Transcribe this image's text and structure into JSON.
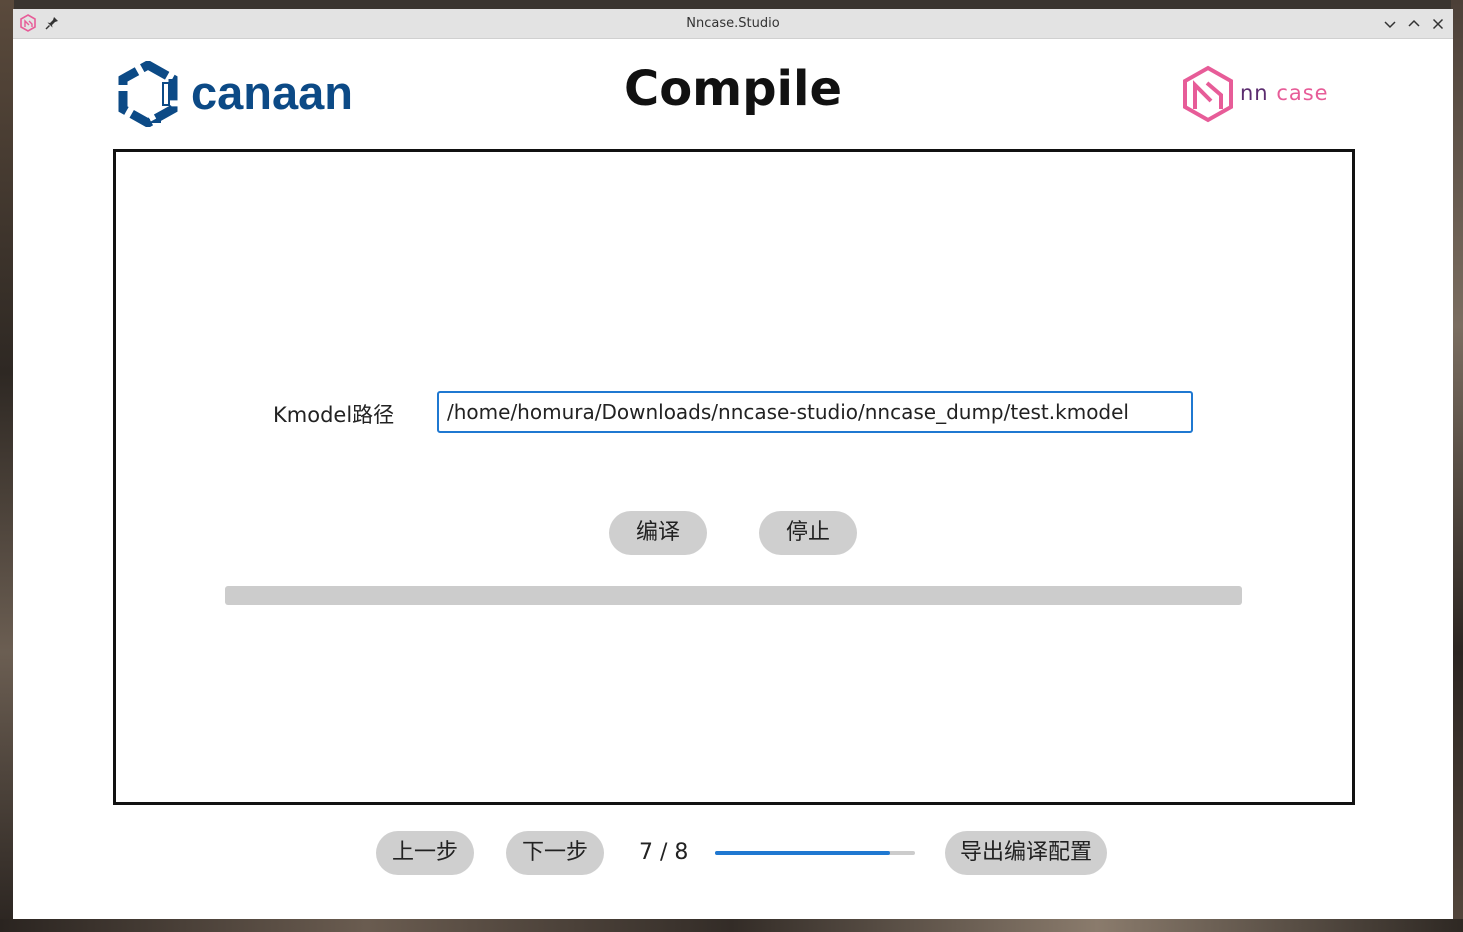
{
  "window": {
    "title": "Nncase.Studio",
    "controls": [
      "chevron-down-icon",
      "chevron-up-icon",
      "close-icon"
    ]
  },
  "header": {
    "left_logo_text": "canaan",
    "page_title": "Compile",
    "right_logo_text_nn": "nn",
    "right_logo_text_case": "case"
  },
  "compile": {
    "kmodel_label": "Kmodel路径",
    "kmodel_path": "/home/homura/Downloads/nncase-studio/nncase_dump/test.kmodel",
    "compile_button": "编译",
    "stop_button": "停止",
    "progress": 0
  },
  "footer": {
    "prev_button": "上一步",
    "next_button": "下一步",
    "step_indicator": "7 / 8",
    "step_progress": 0.875,
    "export_button": "导出编译配置"
  },
  "colors": {
    "accent": "#1f78d1",
    "canaan_blue": "#0c4a86",
    "nncase_purple": "#5b2c6f",
    "nncase_pink": "#e75c98",
    "pill_gray": "#cfcfcf"
  }
}
